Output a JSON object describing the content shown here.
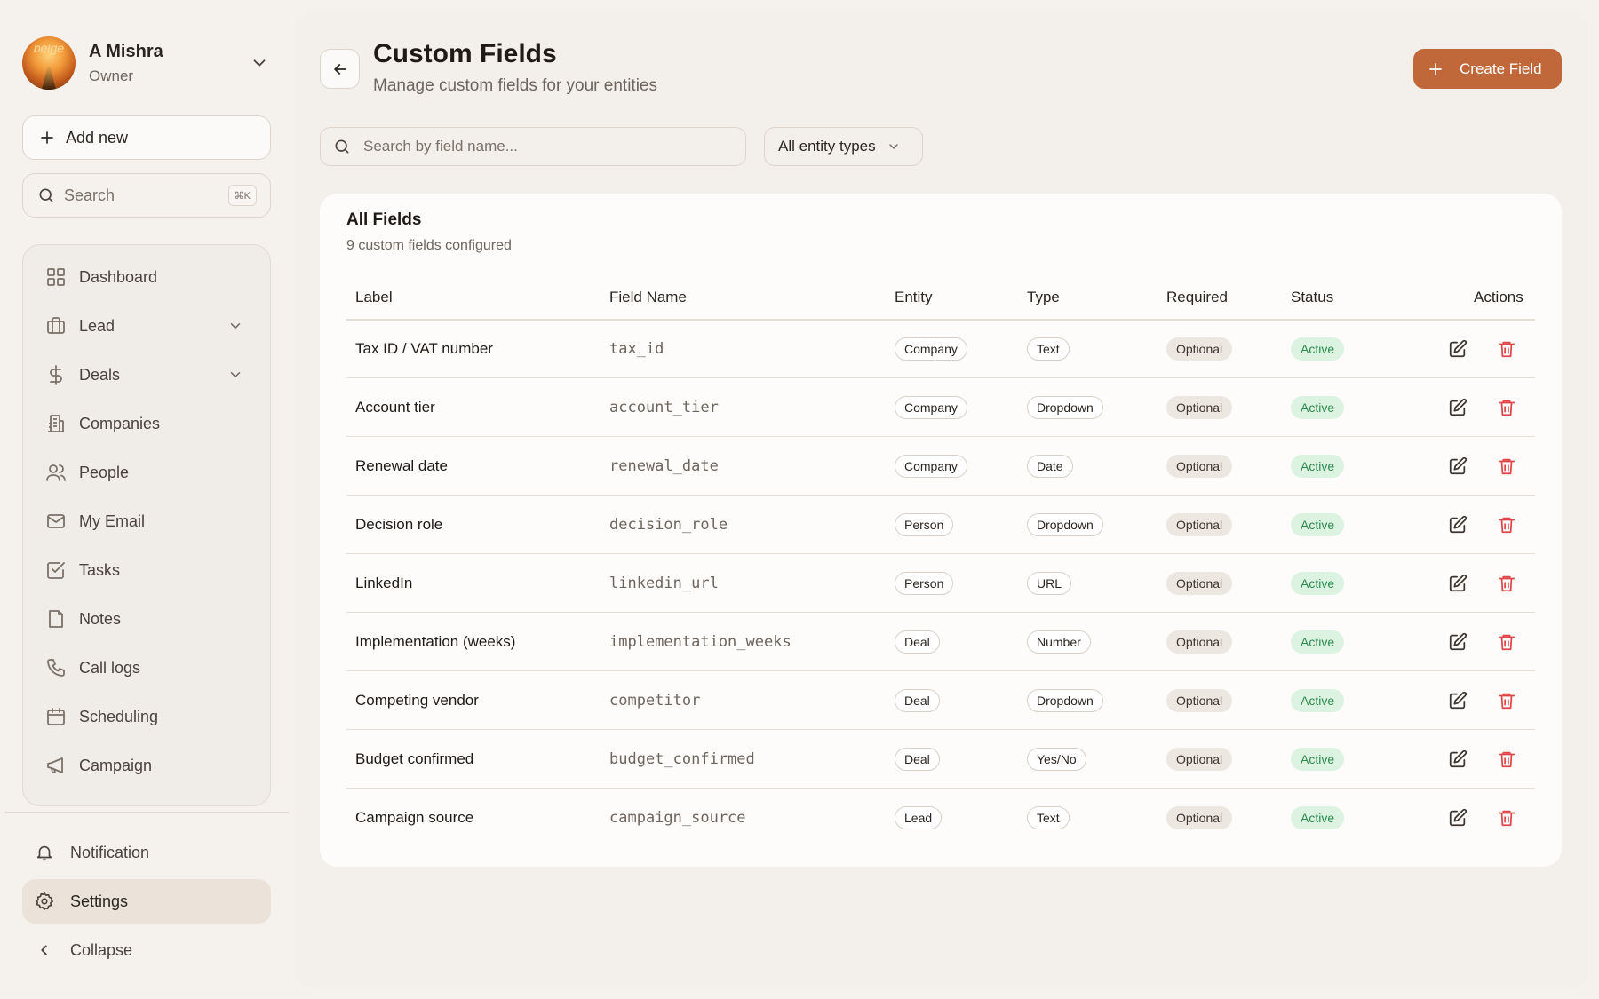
{
  "profile": {
    "name": "A Mishra",
    "role": "Owner",
    "avatar_text": "beige"
  },
  "sidebar": {
    "add_new_label": "Add new",
    "search_placeholder": "Search",
    "search_shortcut": "⌘K",
    "items": [
      {
        "label": "Dashboard",
        "icon": "grid-icon"
      },
      {
        "label": "Lead",
        "icon": "briefcase-icon",
        "expandable": true
      },
      {
        "label": "Deals",
        "icon": "dollar-icon",
        "expandable": true
      },
      {
        "label": "Companies",
        "icon": "building-icon"
      },
      {
        "label": "People",
        "icon": "users-icon"
      },
      {
        "label": "My Email",
        "icon": "mail-icon"
      },
      {
        "label": "Tasks",
        "icon": "checkbox-icon"
      },
      {
        "label": "Notes",
        "icon": "note-icon"
      },
      {
        "label": "Call logs",
        "icon": "phone-icon"
      },
      {
        "label": "Scheduling",
        "icon": "calendar-icon"
      },
      {
        "label": "Campaign",
        "icon": "megaphone-icon"
      }
    ],
    "bottom": {
      "notification_label": "Notification",
      "settings_label": "Settings",
      "collapse_label": "Collapse"
    }
  },
  "header": {
    "title": "Custom Fields",
    "subtitle": "Manage custom fields for your entities",
    "create_label": "Create Field"
  },
  "filters": {
    "search_placeholder": "Search by field name...",
    "entity_select": "All entity types"
  },
  "table": {
    "title": "All Fields",
    "subtitle": "9 custom fields configured",
    "columns": [
      "Label",
      "Field Name",
      "Entity",
      "Type",
      "Required",
      "Status",
      "Actions"
    ],
    "rows": [
      {
        "label": "Tax ID / VAT number",
        "field": "tax_id",
        "entity": "Company",
        "type": "Text",
        "required": "Optional",
        "status": "Active"
      },
      {
        "label": "Account tier",
        "field": "account_tier",
        "entity": "Company",
        "type": "Dropdown",
        "required": "Optional",
        "status": "Active"
      },
      {
        "label": "Renewal date",
        "field": "renewal_date",
        "entity": "Company",
        "type": "Date",
        "required": "Optional",
        "status": "Active"
      },
      {
        "label": "Decision role",
        "field": "decision_role",
        "entity": "Person",
        "type": "Dropdown",
        "required": "Optional",
        "status": "Active"
      },
      {
        "label": "LinkedIn",
        "field": "linkedin_url",
        "entity": "Person",
        "type": "URL",
        "required": "Optional",
        "status": "Active"
      },
      {
        "label": "Implementation (weeks)",
        "field": "implementation_weeks",
        "entity": "Deal",
        "type": "Number",
        "required": "Optional",
        "status": "Active"
      },
      {
        "label": "Competing vendor",
        "field": "competitor",
        "entity": "Deal",
        "type": "Dropdown",
        "required": "Optional",
        "status": "Active"
      },
      {
        "label": "Budget confirmed",
        "field": "budget_confirmed",
        "entity": "Deal",
        "type": "Yes/No",
        "required": "Optional",
        "status": "Active"
      },
      {
        "label": "Campaign source",
        "field": "campaign_source",
        "entity": "Lead",
        "type": "Text",
        "required": "Optional",
        "status": "Active"
      }
    ]
  },
  "colors": {
    "accent": "#c0683a",
    "active_bg": "#dcf3e2",
    "active_text": "#2e8a4f",
    "delete": "#e0454a"
  }
}
